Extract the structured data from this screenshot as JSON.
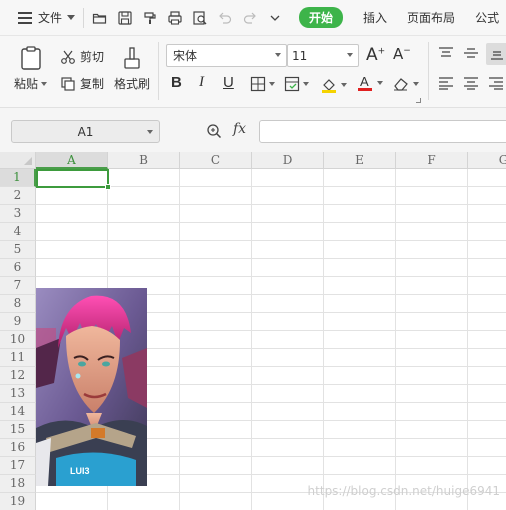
{
  "menubar": {
    "file_label": "文件",
    "quick_icons": [
      "open-folder-icon",
      "save-icon",
      "format-painter-icon",
      "print-icon",
      "print-preview-icon",
      "undo-icon",
      "redo-icon",
      "more-icon"
    ],
    "tabs": [
      "开始",
      "插入",
      "页面布局",
      "公式"
    ],
    "active_tab": "开始",
    "accent": "#3db44a"
  },
  "ribbon": {
    "paste_label": "粘贴",
    "cut_label": "剪切",
    "copy_label": "复制",
    "format_painter_label": "格式刷",
    "font_name": "宋体",
    "font_size": "11",
    "bold_label": "B",
    "italic_label": "I",
    "underline_label": "U",
    "font_color": "#e02020",
    "fill_color": "#f5d300"
  },
  "formula_bar": {
    "name_box": "A1",
    "fx_label": "fx",
    "formula": ""
  },
  "sheet": {
    "columns": [
      "A",
      "B",
      "C",
      "D",
      "E",
      "F",
      "G"
    ],
    "rows": [
      "1",
      "2",
      "3",
      "4",
      "5",
      "6",
      "7",
      "8",
      "9",
      "10",
      "11",
      "12",
      "13",
      "14",
      "15",
      "16",
      "17",
      "18",
      "19"
    ],
    "active_cell": "A1",
    "selection_color": "#3d9b3d"
  },
  "watermark": "https://blog.csdn.net/huige6941"
}
